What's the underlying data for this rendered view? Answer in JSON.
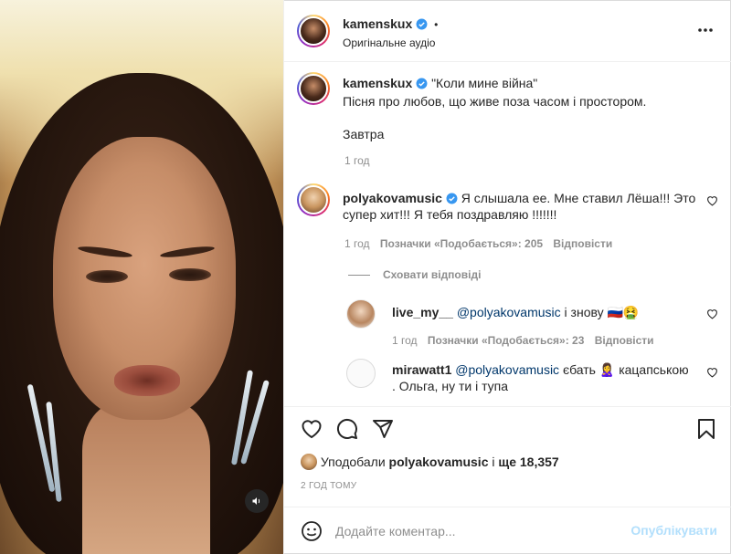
{
  "post": {
    "author": "kamenskux",
    "audio": "Оригінальне аудіо",
    "caption_line1": "\"Коли мине війна\"",
    "caption_line2": "Пісня про любов, що живе поза часом і простором.",
    "caption_line3": "Завтра",
    "caption_time": "1 год"
  },
  "comments": [
    {
      "user": "polyakovamusic",
      "text_line1": "Я слышала ее. Мне ставил Лёша!!! Это",
      "text_line2": "супер хит!!! Я тебя поздравляю !!!!!!!",
      "time": "1 год",
      "likes": "Позначки «Подобається»: 205",
      "reply": "Відповісти",
      "hide_replies": "Сховати відповіді"
    }
  ],
  "replies": [
    {
      "user": "live_my__",
      "mention": "@polyakovamusic",
      "text": "і знову 🇷🇺🤮",
      "time": "1 год",
      "likes": "Позначки «Подобається»: 23",
      "reply": "Відповісти"
    },
    {
      "user": "mirawatt1",
      "mention": "@polyakovamusic",
      "text_line1": "єбать 🙎‍♀️ кацапською",
      "text_line2": ". Ольга, ну ти і тупа"
    }
  ],
  "footer": {
    "likes_prefix": "Уподобали",
    "likes_user": "polyakovamusic",
    "likes_mid": "і",
    "likes_more": "ще 18,357",
    "time_ago": "2 ГОД ТОМУ",
    "comment_placeholder": "Додайте коментар...",
    "publish_label": "Опублікувати"
  },
  "icons": {
    "verified": "verified-badge-icon",
    "more": "more-options-icon",
    "heart": "heart-icon",
    "comment": "comment-icon",
    "share": "share-icon",
    "bookmark": "bookmark-icon",
    "emoji": "emoji-icon",
    "audio": "speaker-icon"
  },
  "colors": {
    "verified": "#3897f0",
    "muted_text": "#8e8e8e",
    "publish_disabled": "#b2dffc"
  }
}
